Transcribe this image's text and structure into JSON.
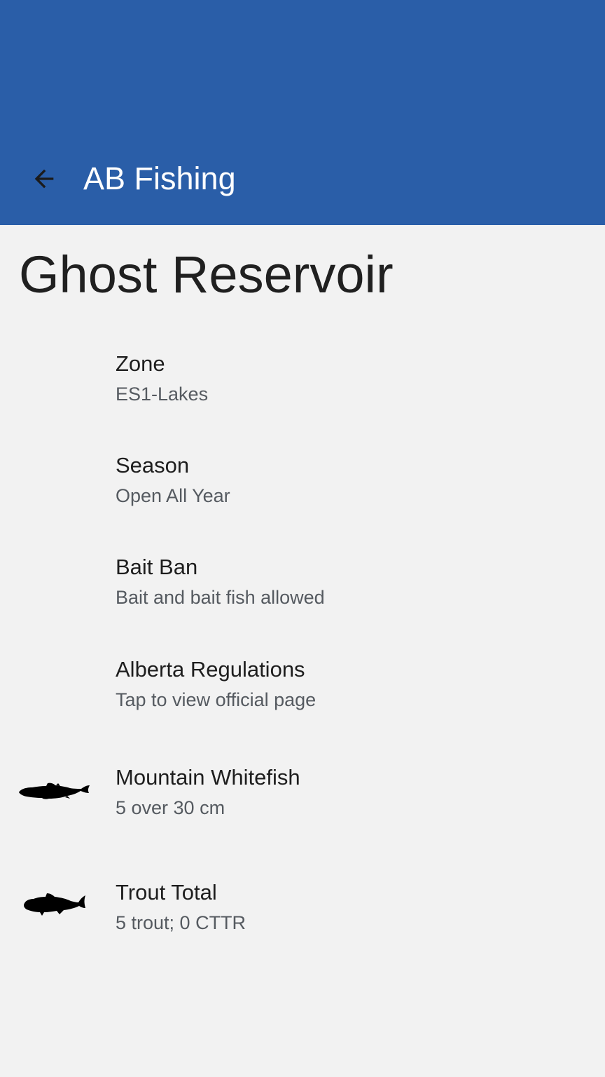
{
  "app_bar": {
    "title": "AB Fishing",
    "back_icon": "arrow-back-icon",
    "background": "#2a5ea8"
  },
  "page": {
    "title": "Ghost Reservoir"
  },
  "items": [
    {
      "title": "Zone",
      "subtitle": "ES1-Lakes",
      "icon": null
    },
    {
      "title": "Season",
      "subtitle": "Open All Year",
      "icon": null
    },
    {
      "title": "Bait Ban",
      "subtitle": "Bait and bait fish allowed",
      "icon": null
    },
    {
      "title": "Alberta Regulations",
      "subtitle": "Tap to view official page",
      "icon": null
    },
    {
      "title": "Mountain Whitefish",
      "subtitle": "5 over 30 cm",
      "icon": "whitefish-icon"
    },
    {
      "title": "Trout Total",
      "subtitle": "5 trout; 0 CTTR",
      "icon": "trout-icon"
    }
  ]
}
